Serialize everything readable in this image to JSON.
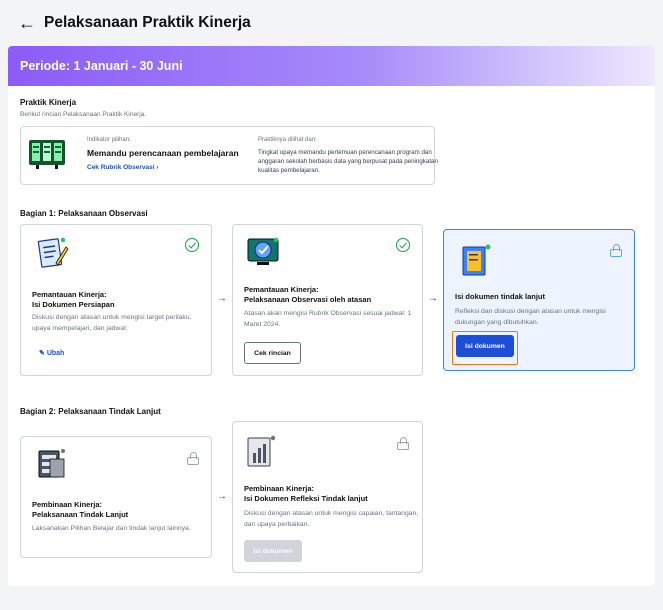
{
  "header": {
    "back_icon": "arrow-left-icon",
    "title": "Pelaksanaan Praktik Kinerja"
  },
  "period": {
    "label": "Periode: 1 Januari - 30 Juni"
  },
  "practice": {
    "title": "Praktik Kinerja",
    "subtitle": "Berikut rincian Pelaksanaan Praktik Kinerja.",
    "indicator_label": "Indikator pilihan:",
    "indicator_value": "Memandu perencanaan pembelajaran",
    "rubric_link": "Cek Rubrik Observasi",
    "seen_label": "Praktiknya dilihat dari:",
    "seen_desc": "Tingkat upaya memandu pertemuan perencanaan program dan anggaran sekolah berbasis data yang berpusat pada peningkatan kualitas pembelajaran."
  },
  "section1": {
    "title": "Bagian 1: Pelaksanaan Observasi",
    "cards": [
      {
        "title_l1": "Pemantauan Kinerja:",
        "title_l2": "Isi Dokumen Persiapan",
        "desc": "Diskusi dengan atasan untuk mengisi target perilaku, upaya mempelajari, dan jadwal.",
        "action": "Ubah",
        "status": "completed"
      },
      {
        "title_l1": "Pemantauan Kinerja:",
        "title_l2": "Pelaksanaan Observasi oleh atasan",
        "desc": "Atasan akan mengisi Rubrik Observasi sesuai jadwal: 1 Maret 2024.",
        "action": "Cek rincian",
        "status": "completed"
      },
      {
        "title_l1": "Isi dokumen tindak lanjut",
        "desc": "Refleksi dan diskusi dengan atasan untuk mengisi dukungan yang dibutuhkan.",
        "action": "Isi dokumen",
        "status": "locked"
      }
    ]
  },
  "section2": {
    "title": "Bagian 2: Pelaksanaan Tindak Lanjut",
    "cards": [
      {
        "title_l1": "Pembinaan Kinerja:",
        "title_l2": "Pelaksanaan Tindak Lanjut",
        "desc": "Laksanakan Pilihan Belajar dan tindak lanjut lainnya.",
        "status": "locked"
      },
      {
        "title_l1": "Pembinaan Kinerja:",
        "title_l2": "Isi Dokumen Refleksi Tindak lanjut",
        "desc": "Diskusi dengan atasan untuk mengisi capaian, tantangan, dan upaya perbaikan.",
        "action": "Isi dokumen",
        "status": "locked"
      }
    ]
  },
  "colors": {
    "accent": "#1d4ed8",
    "period_start": "#8b5cf6",
    "success": "#16a34a",
    "focus": "#f97316"
  }
}
